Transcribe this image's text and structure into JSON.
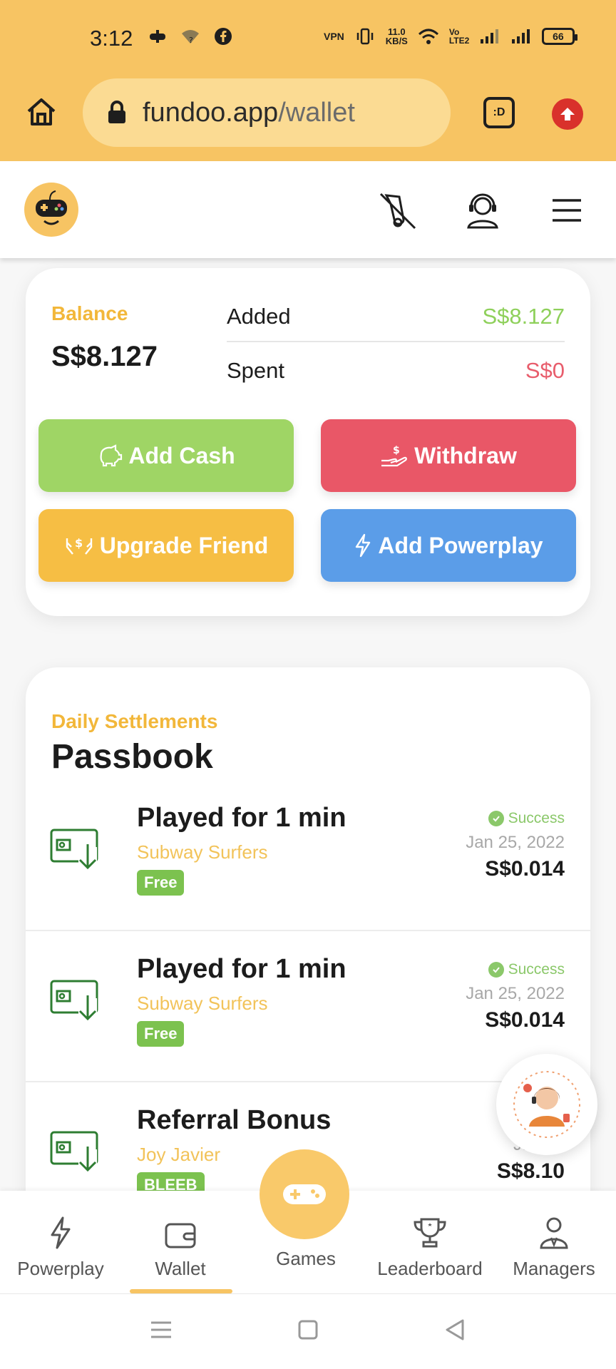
{
  "status_bar": {
    "time": "3:12",
    "speed": "11.0",
    "speed_unit": "KB/S",
    "battery": "66",
    "vpn": "VPN",
    "volte": "Vo LTE2"
  },
  "browser": {
    "url_domain": "fundoo.app",
    "url_path": "/wallet",
    "tab_label": ":D"
  },
  "balance": {
    "label": "Balance",
    "value": "S$8.127",
    "added_label": "Added",
    "added_value": "S$8.127",
    "spent_label": "Spent",
    "spent_value": "S$0"
  },
  "actions": {
    "add_cash": "Add Cash",
    "withdraw": "Withdraw",
    "upgrade_friend": "Upgrade Friend",
    "add_powerplay": "Add Powerplay"
  },
  "passbook": {
    "subtitle": "Daily Settlements",
    "title": "Passbook",
    "transactions": [
      {
        "title": "Played for 1 min",
        "sub": "Subway Surfers",
        "tag": "Free",
        "status": "Success",
        "date": "Jan 25, 2022",
        "amount": "S$0.014"
      },
      {
        "title": "Played for 1 min",
        "sub": "Subway Surfers",
        "tag": "Free",
        "status": "Success",
        "date": "Jan 25, 2022",
        "amount": "S$0.014"
      },
      {
        "title": "Referral Bonus",
        "sub": "Joy Javier",
        "tag": "BLEEB",
        "status": "",
        "date": "Jan 25",
        "amount": "S$8.10"
      }
    ]
  },
  "bottom_nav": {
    "powerplay": "Powerplay",
    "wallet": "Wallet",
    "games": "Games",
    "leaderboard": "Leaderboard",
    "managers": "Managers"
  },
  "colors": {
    "brand": "#f7c463",
    "add_cash": "#9fd565",
    "withdraw": "#e95767",
    "upgrade": "#f6be44",
    "powerplay": "#5b9de8"
  }
}
